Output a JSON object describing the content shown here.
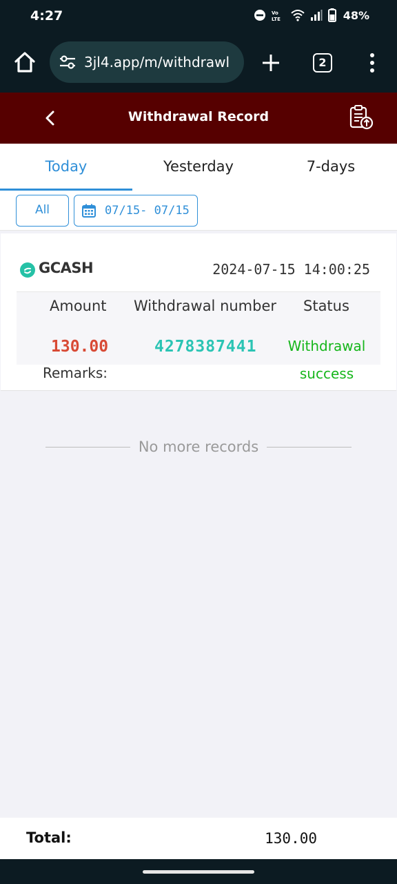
{
  "status_bar": {
    "time": "4:27",
    "network_label": "Vo LTE",
    "battery": "48%"
  },
  "browser": {
    "url": "3jl4.app/m/withdrawl",
    "tab_count": "2",
    "icons": [
      "home-icon",
      "tune-icon",
      "plus-icon",
      "tabs-icon",
      "more-vert-icon"
    ]
  },
  "header": {
    "title": "Withdrawal Record",
    "color": "#560000"
  },
  "tabs": [
    {
      "label": "Today",
      "active": true
    },
    {
      "label": "Yesterday",
      "active": false
    },
    {
      "label": "7-days",
      "active": false
    }
  ],
  "filters": {
    "all_label": "All",
    "date_range": "07/15- 07/15",
    "accent": "#2f8fd8"
  },
  "records": [
    {
      "method": "GCASH",
      "datetime": "2024-07-15 14:00:25",
      "columns": {
        "amount": "Amount",
        "number": "Withdrawal number",
        "status": "Status"
      },
      "amount": "130.00",
      "withdrawal_number": "4278387441",
      "status_line1": "Withdrawal",
      "status_line2": "success",
      "remarks_label": "Remarks:"
    }
  ],
  "list_end_text": "No more records",
  "footer": {
    "total_label": "Total:",
    "total_value": "130.00"
  }
}
